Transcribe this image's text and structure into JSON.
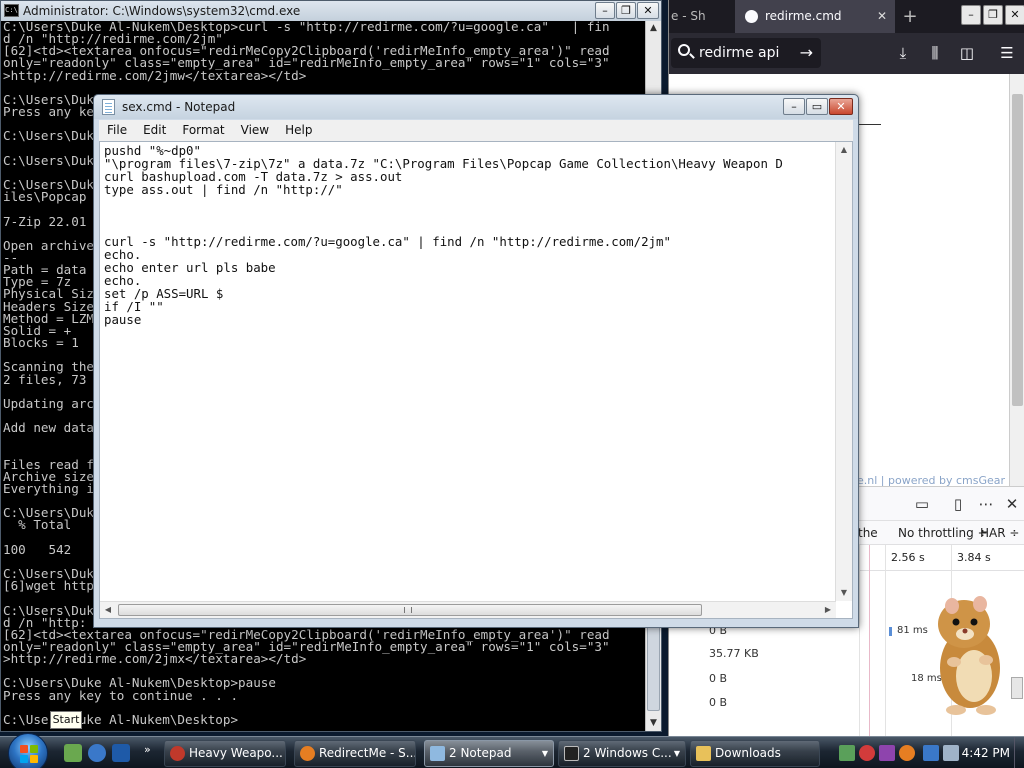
{
  "cmd": {
    "title": "Administrator: C:\\Windows\\system32\\cmd.exe",
    "lines": [
      "C:\\Users\\Duke Al-Nukem\\Desktop>curl -s \"http://redirme.com/?u=google.ca\"   | fin",
      "d /n \"http://redirme.com/2jm\"",
      "[62]<td><textarea onfocus=\"redirMeCopy2Clipboard('redirMeInfo_empty_area')\" read",
      "only=\"readonly\" class=\"empty_area\" id=\"redirMeInfo_empty_area\" rows=\"1\" cols=\"3\"",
      ">http://redirme.com/2jmw</textarea></td>",
      "",
      "C:\\Users\\Duk",
      "Press any ke",
      "",
      "C:\\Users\\Duk",
      "",
      "C:\\Users\\Duk",
      "",
      "C:\\Users\\Duk",
      "iles\\Popcap",
      "",
      "7-Zip 22.01",
      "",
      "Open archive",
      "--",
      "Path = data",
      "Type = 7z",
      "Physical Siz",
      "Headers Size",
      "Method = LZM",
      "Solid = +",
      "Blocks = 1",
      "",
      "Scanning the",
      "2 files, 73",
      "",
      "Updating arc",
      "",
      "Add new data",
      "",
      "",
      "Files read f",
      "Archive size",
      "Everything i",
      "",
      "C:\\Users\\Duk",
      "  % Total",
      "",
      "100   542",
      "",
      "C:\\Users\\Duk",
      "[6]wget http",
      "",
      "C:\\Users\\Duk",
      "d /n \"http:",
      "[62]<td><textarea onfocus=\"redirMeCopy2Clipboard('redirMeInfo_empty_area')\" read",
      "only=\"readonly\" class=\"empty_area\" id=\"redirMeInfo_empty_area\" rows=\"1\" cols=\"3\"",
      ">http://redirme.com/2jmx</textarea></td>",
      "",
      "C:\\Users\\Duke Al-Nukem\\Desktop>pause",
      "Press any key to continue . . .",
      "",
      "C:\\Users\\Duke Al-Nukem\\Desktop>"
    ]
  },
  "browser": {
    "tabs": [
      {
        "label": "e - Sh"
      },
      {
        "label": "redirme.cmd"
      }
    ],
    "new_tab_glyph": "+",
    "search_value": "redirme api",
    "go_glyph": "→",
    "page_footer": "e.nl | powered by cmsGear",
    "devtools": {
      "throttle": "No throttling ÷",
      "har": "HAR ÷",
      "cache_label": "the",
      "timeline": [
        "2.56 s",
        "3.84 s"
      ],
      "rows": [
        {
          "size": "0 B",
          "timing": "81 ms"
        },
        {
          "size": "35.77 KB",
          "timing": ""
        },
        {
          "size": "0 B",
          "timing": "18 ms"
        },
        {
          "size": "0 B",
          "timing": ""
        }
      ]
    }
  },
  "notepad": {
    "title": "sex.cmd - Notepad",
    "menu": [
      "File",
      "Edit",
      "Format",
      "View",
      "Help"
    ],
    "lines": [
      "pushd \"%~dp0\"",
      "\"\\program files\\7-zip\\7z\" a data.7z \"C:\\Program Files\\Popcap Game Collection\\Heavy Weapon D",
      "curl bashupload.com -T data.7z > ass.out",
      "type ass.out | find /n \"http://\"",
      "",
      "",
      "",
      "curl -s \"http://redirme.com/?u=google.ca\" | find /n \"http://redirme.com/2jm\"",
      "echo.",
      "echo enter url pls babe",
      "echo.",
      "set /p ASS=URL $",
      "if /I \"\"",
      "pause"
    ]
  },
  "taskbar": {
    "start_tooltip": "Start",
    "buttons": [
      {
        "label": "Heavy Weapo...",
        "color": "#c0392b"
      },
      {
        "label": "RedirectMe - S...",
        "color": "#e67e22"
      },
      {
        "label": "2 Notepad",
        "color": "#8fb9e0"
      },
      {
        "label": "2 Windows C...",
        "color": "#222222"
      },
      {
        "label": "Downloads",
        "color": "#e8c15a"
      }
    ],
    "time": "4:42 PM"
  },
  "colors": {
    "cmd_background": "#000000",
    "cmd_text": "#c8c8c8",
    "firefox_dark": "#1c1b22",
    "accent_blue": "#2d74c4"
  }
}
